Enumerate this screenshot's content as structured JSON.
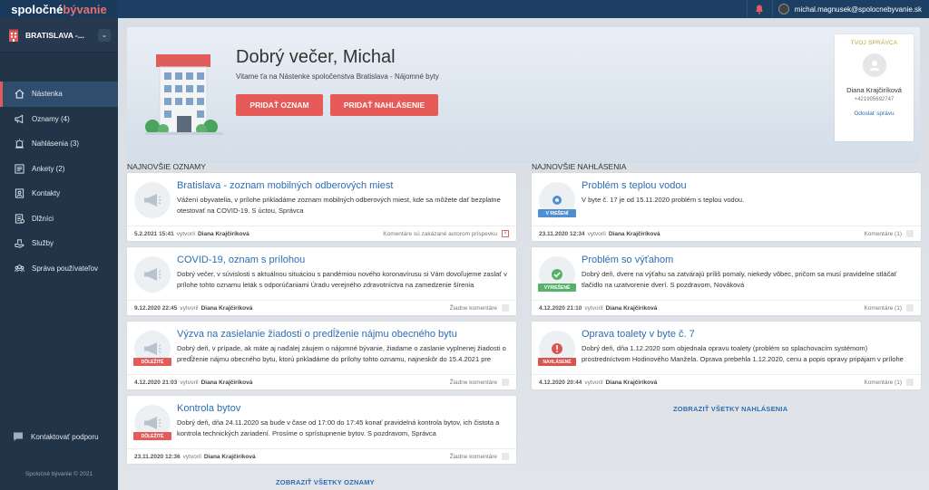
{
  "app": {
    "logo_part1": "spoločné",
    "logo_part2": "bývanie",
    "user_email": "michal.magnusek@spolocnebyvanie.sk"
  },
  "sidebar": {
    "city": "BRATISLAVA -...",
    "items": [
      {
        "label": "Nástenka",
        "icon": "home-icon",
        "active": true
      },
      {
        "label": "Oznamy (4)",
        "icon": "megaphone-icon"
      },
      {
        "label": "Nahlásenia (3)",
        "icon": "alarm-icon"
      },
      {
        "label": "Ankety (2)",
        "icon": "poll-icon"
      },
      {
        "label": "Kontakty",
        "icon": "contacts-icon"
      },
      {
        "label": "Dlžníci",
        "icon": "debtors-icon"
      },
      {
        "label": "Služby",
        "icon": "services-icon"
      },
      {
        "label": "Správa používateľov",
        "icon": "users-icon"
      }
    ],
    "support": "Kontaktovať podporu",
    "copyright": "Spoločné bývanie © 2021"
  },
  "hero": {
    "title": "Dobrý večer, Michal",
    "subtitle": "Vitame ťa na Nástenke spoločenstva Bratislava - Nájomné byty",
    "btn_announce": "PRIDAŤ OZNAM",
    "btn_report": "PRIDAŤ NAHLÁSENIE"
  },
  "manager": {
    "label": "TVOJ SPRÁVCA",
    "name": "Diana Krajčiríková",
    "phone": "+421905692747",
    "link": "Odoslať správu"
  },
  "announcements": {
    "title": "NAJNOVŠIE OZNAMY",
    "show_all": "ZOBRAZIŤ VŠETKY OZNAMY",
    "items": [
      {
        "title": "Bratislava - zoznam mobilných odberových miest",
        "text": "Vážení obyvatelia, v prílohe prikladáme zoznam mobilných odberových miest, kde sa môžete dať bezplatne otestovať na COVID-19. S úctou, Správca",
        "date": "5.2.2021 15:41",
        "by": "vytvoril",
        "author": "Diana Krajčiríková",
        "comments": "Komentáre sú zakázané autorom príspevku",
        "badge": ""
      },
      {
        "title": "COVID-19, oznam s prílohou",
        "text": "Dobrý večer, v súvislosti s aktuálnou situáciou s pandémiou nového koronavírusu si Vám dovoľujeme zaslať v prílohe tohto oznamu leták s odporúčaniami Úradu verejného zdravotníctva na zamedzenie šírenia",
        "date": "9.12.2020 22:45",
        "by": "vytvoril",
        "author": "Diana Krajčiríková",
        "comments": "Žiadne komentáre",
        "badge": ""
      },
      {
        "title": "Výzva na zasielanie žiadosti o predĺženie nájmu obecného bytu",
        "text": "Dobrý deň, v prípade, ak máte aj naďalej záujem o nájomné bývanie, žiadame o zaslanie vyplnenej žiadosti o predĺženie nájmu obecného bytu, ktorú prikladáme do prílohy tohto oznamu, najneskôr do 15.4.2021 pre",
        "date": "4.12.2020 21:03",
        "by": "vytvoril",
        "author": "Diana Krajčiríková",
        "comments": "Žiadne komentáre",
        "badge": "DÔLEŽITÉ"
      },
      {
        "title": "Kontrola bytov",
        "text": "Dobrý deň, dňa 24.11.2020 sa bude v čase od 17:00 do 17:45 konať pravidelná kontrola bytov, ich čistota a kontrola technických zariadení. Prosíme o sprístupnenie bytov. S pozdravom, Správca",
        "date": "23.11.2020 12:36",
        "by": "vytvoril",
        "author": "Diana Krajčiríková",
        "comments": "Žiadne komentáre",
        "badge": "DÔLEŽITÉ"
      }
    ]
  },
  "reports": {
    "title": "NAJNOVŠIE NAHLÁSENIA",
    "show_all": "ZOBRAZIŤ VŠETKY NAHLÁSENIA",
    "items": [
      {
        "title": "Problém s teplou vodou",
        "text": "V byte č. 17 je od 15.11.2020 problém s teplou vodou.",
        "date": "23.11.2020 12:34",
        "by": "vytvoril",
        "author": "Diana Krajčiríková",
        "comments": "Komentáre (1)",
        "badge": "V RIEŠENÍ",
        "badge_color": "#4f8fd1"
      },
      {
        "title": "Problém so výťahom",
        "text": "Dobrý deň, dvere na výťahu sa zatvárajú príliš pomaly, niekedy vôbec, pričom sa musí pravidelne stláčať tlačidlo na uzatvorenie dverí. S pozdravom, Nováková",
        "date": "4.12.2020 21:10",
        "by": "vytvoril",
        "author": "Diana Krajčiríková",
        "comments": "Komentáre (1)",
        "badge": "VYRIEŠENÉ",
        "badge_color": "#56b26a"
      },
      {
        "title": "Oprava toalety v byte č. 7",
        "text": "Dobrý deň, dňa 1.12.2020 som objednala opravu toalety (problém so splachovacím systémom) prostredníctvom Hodinového Manžela. Oprava prebehla 1.12.2020, cenu a popis opravy pripájam v prílohe",
        "date": "4.12.2020 20:44",
        "by": "vytvoril",
        "author": "Diana Krajčiríková",
        "comments": "Komentáre (1)",
        "badge": "NAHLÁSENÉ",
        "badge_color": "#d9534f"
      }
    ]
  }
}
